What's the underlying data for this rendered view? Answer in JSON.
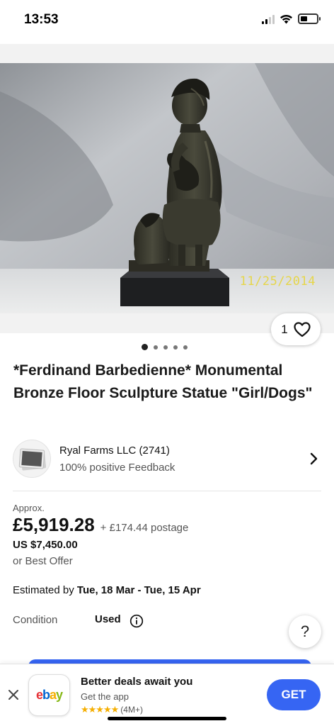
{
  "status_bar": {
    "time": "13:53",
    "battery_level": 0.45
  },
  "gallery": {
    "image_description": "Bronze sculpture of a girl holding a puppy with a dog at her feet",
    "date_stamp": "11/25/2014",
    "watch_count": "1",
    "image_count": 5,
    "active_image": 1
  },
  "listing": {
    "title": "*Ferdinand Barbedienne* Monumental Bronze Floor Sculpture Statue \"Girl/Dogs\""
  },
  "seller": {
    "name": "Ryal Farms LLC (2741)",
    "feedback": "100% positive Feedback"
  },
  "pricing": {
    "approx_label": "Approx.",
    "price": "£5,919.28",
    "postage": "+ £174.44 postage",
    "usd_price": "US $7,450.00",
    "best_offer": "or Best Offer"
  },
  "delivery": {
    "label": "Estimated by",
    "dates": "Tue, 18 Mar - Tue, 15 Apr"
  },
  "condition": {
    "label": "Condition",
    "value": "Used"
  },
  "help": {
    "label": "?"
  },
  "app_banner": {
    "title": "Better deals await you",
    "subtitle": "Get the app",
    "stars": "★★★★★",
    "rating_count": "(4M+)",
    "get_label": "GET",
    "brand_colors": {
      "e": "#e53238",
      "b": "#0064d2",
      "a": "#f5af02",
      "y": "#86b817"
    },
    "accent": "#3665f3"
  }
}
